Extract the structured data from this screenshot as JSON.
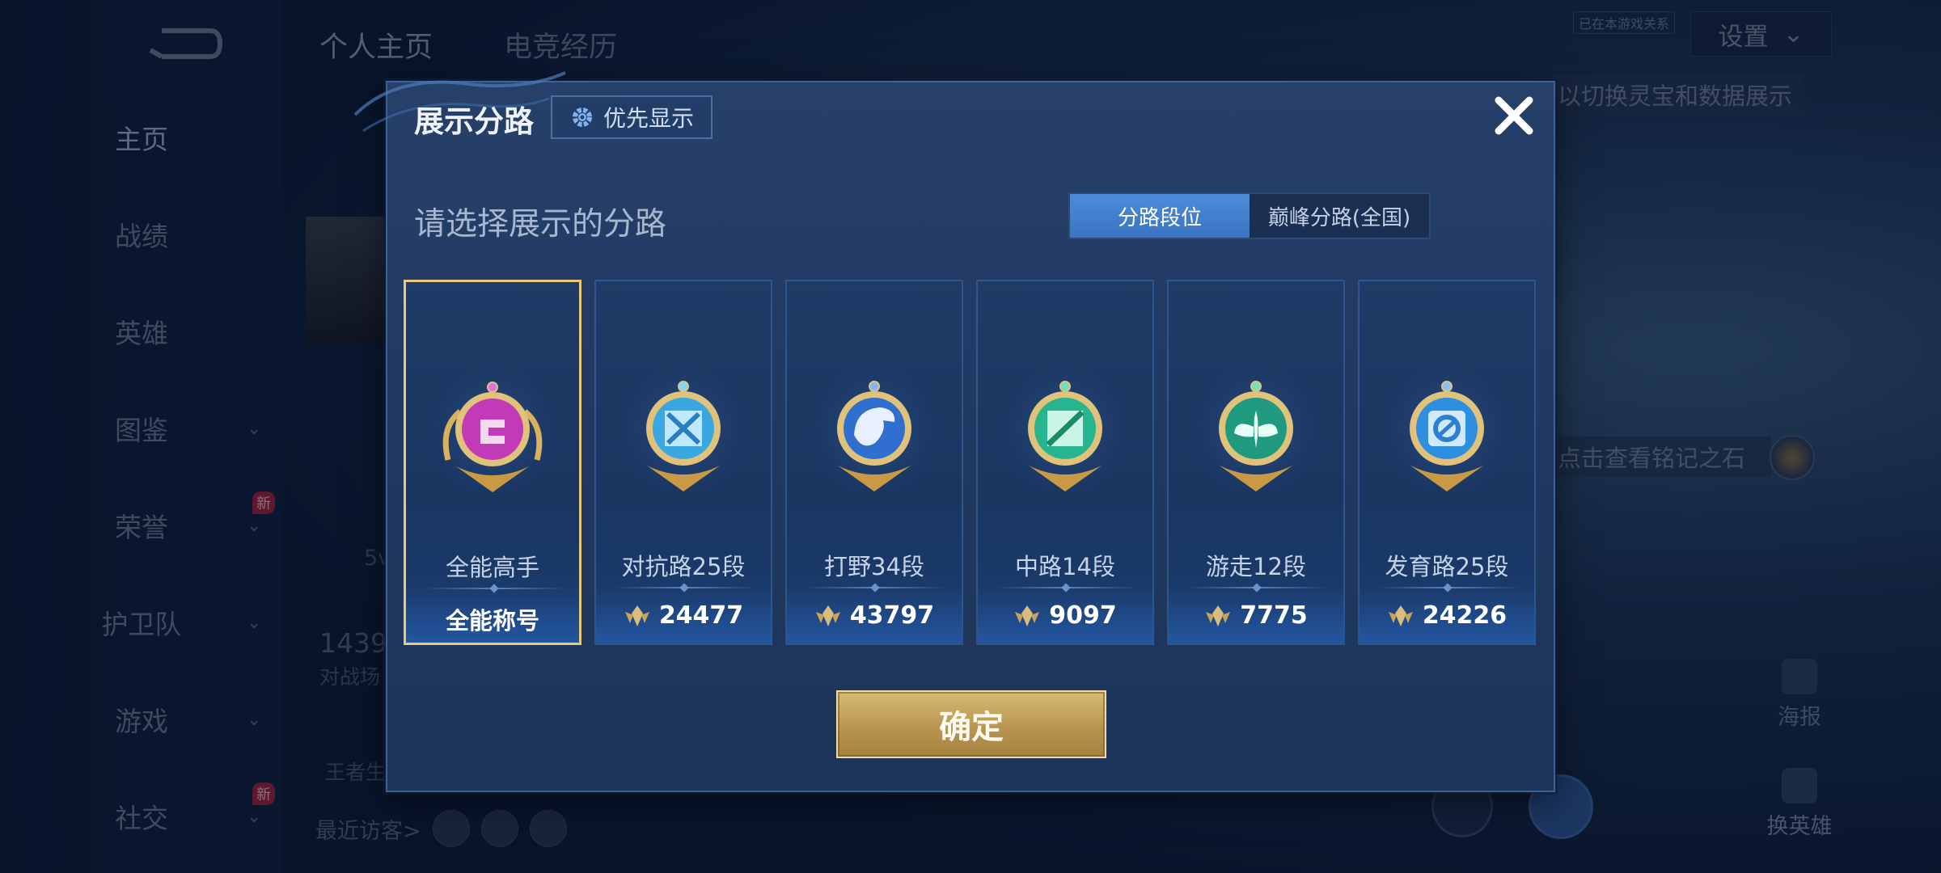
{
  "background": {
    "top_tabs": [
      {
        "label": "个人主页",
        "active": true
      },
      {
        "label": "电竞经历",
        "active": false
      }
    ],
    "side_nav": [
      {
        "label": "主页",
        "active": true,
        "chevron": false,
        "new": false
      },
      {
        "label": "战绩",
        "active": false,
        "chevron": false,
        "new": false
      },
      {
        "label": "英雄",
        "active": false,
        "chevron": false,
        "new": false
      },
      {
        "label": "图鉴",
        "active": false,
        "chevron": true,
        "new": false
      },
      {
        "label": "荣誉",
        "active": false,
        "chevron": true,
        "new": true
      },
      {
        "label": "护卫队",
        "active": false,
        "chevron": true,
        "new": false
      },
      {
        "label": "游戏",
        "active": false,
        "chevron": true,
        "new": false
      },
      {
        "label": "社交",
        "active": false,
        "chevron": true,
        "new": true
      }
    ],
    "new_badge": "新",
    "settings_label": "设置",
    "settings_badge": "已在本游戏关系",
    "hint_top": "以切换灵宝和数据展示",
    "hint_mid": "点击查看铭记之石",
    "poster_label": "海报",
    "swap_hero_label": "换英雄",
    "recent_visitors_label": "最近访客>",
    "stat_number": "1439",
    "stat_label": "对战场",
    "sub_number": "5v",
    "king_label": "王者生"
  },
  "modal": {
    "title": "展示分路",
    "priority_button": "优先显示",
    "subtitle": "请选择展示的分路",
    "toggle": [
      {
        "label": "分路段位",
        "active": true
      },
      {
        "label": "巅峰分路(全国)",
        "active": false
      }
    ],
    "cards": [
      {
        "lane": "全能高手",
        "value": "全能称号",
        "type": "title",
        "selected": true,
        "badge_color": "#c23ab8",
        "emblem": "diamond"
      },
      {
        "lane": "对抗路25段",
        "value": "24477",
        "type": "score",
        "selected": false,
        "badge_color": "#3aa8e0",
        "emblem": "cross"
      },
      {
        "lane": "打野34段",
        "value": "43797",
        "type": "score",
        "selected": false,
        "badge_color": "#2f6fcf",
        "emblem": "dragon"
      },
      {
        "lane": "中路14段",
        "value": "9097",
        "type": "score",
        "selected": false,
        "badge_color": "#27b58f",
        "emblem": "slash"
      },
      {
        "lane": "游走12段",
        "value": "7775",
        "type": "score",
        "selected": false,
        "badge_color": "#1f9a7e",
        "emblem": "wings"
      },
      {
        "lane": "发育路25段",
        "value": "24226",
        "type": "score",
        "selected": false,
        "badge_color": "#2e8fe0",
        "emblem": "ring"
      }
    ],
    "confirm_button": "确定",
    "colors": {
      "accent_gold": "#e8c879",
      "toggle_active": "#4d8bd8",
      "score_icon": "#d9bd7a"
    }
  }
}
